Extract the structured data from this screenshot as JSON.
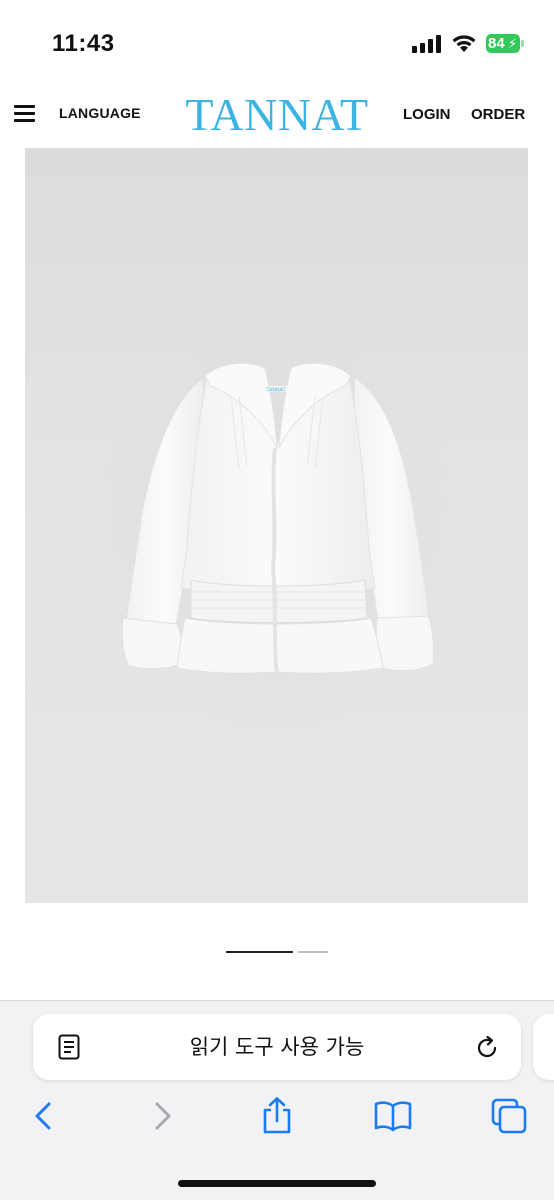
{
  "status_bar": {
    "time": "11:43",
    "battery_level": "84",
    "battery_charging": true,
    "battery_color": "#33c759"
  },
  "header": {
    "menu_icon": "hamburger-menu-icon",
    "language_label": "LANGUAGE",
    "logo_text": "TANNAT",
    "logo_color": "#3bb3e3",
    "login_label": "LOGIN",
    "order_label": "ORDER"
  },
  "product": {
    "image_subject": "white-ruffle-blouse",
    "garment_tag": "TANNAT"
  },
  "slider": {
    "total_slides": 2,
    "active_slide": 1
  },
  "browser": {
    "address_text": "읽기 도구 사용 가능",
    "reader_icon": "reader-page-icon",
    "reload_icon": "reload-icon",
    "toolbar": {
      "back_icon": "chevron-left-icon",
      "forward_icon": "chevron-right-icon",
      "share_icon": "share-icon",
      "bookmarks_icon": "open-book-icon",
      "tabs_icon": "tabs-icon"
    },
    "accent_color": "#1a7cf0"
  }
}
